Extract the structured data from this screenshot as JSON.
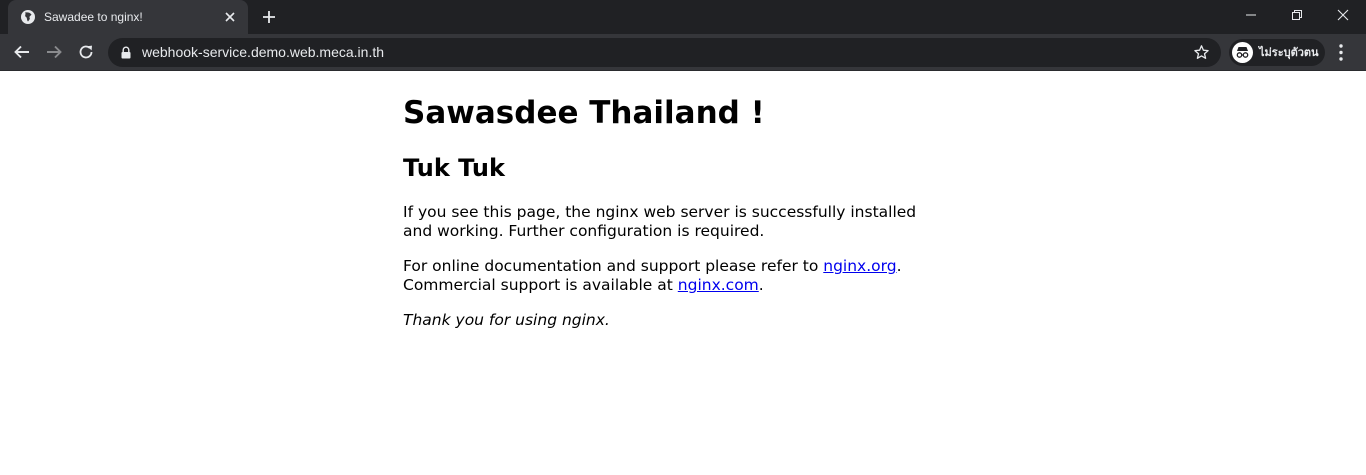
{
  "browser": {
    "tab_title": "Sawadee to nginx!",
    "url": "webhook-service.demo.web.meca.in.th",
    "profile_label": "ไม่ระบุตัวตน"
  },
  "page": {
    "heading": "Sawasdee Thailand !",
    "subheading": "Tuk Tuk",
    "p1": "If you see this page, the nginx web server is successfully installed and working. Further configuration is required.",
    "p2_before_link1": "For online documentation and support please refer to ",
    "link1": "nginx.org",
    "p2_after_link1": ".",
    "p2_line2_before_link2": "Commercial support is available at ",
    "link2": "nginx.com",
    "p2_after_link2": ".",
    "p3": "Thank you for using nginx."
  },
  "colors": {
    "titlebar": "#202124",
    "toolbar": "#35363a",
    "link": "#0000ee"
  }
}
